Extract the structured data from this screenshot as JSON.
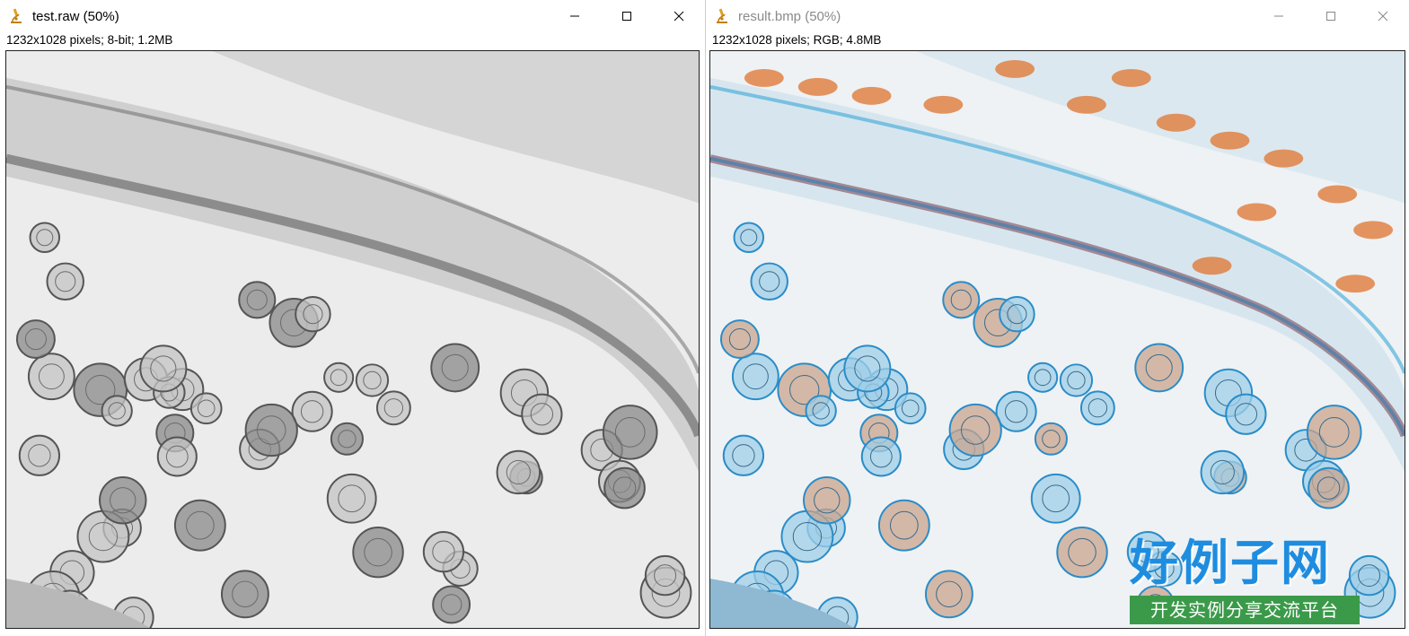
{
  "colors": {
    "brand_blue": "#1e8de0",
    "brand_green": "#3b9a4a",
    "stain_blue": "#3aa6d8",
    "stain_orange": "#e07a3a"
  },
  "windows": [
    {
      "title": "test.raw (50%)",
      "info": "1232x1028 pixels; 8-bit; 1.2MB",
      "icon": "microscope-icon",
      "active": true
    },
    {
      "title": "result.bmp (50%)",
      "info": "1232x1028 pixels; RGB; 4.8MB",
      "icon": "microscope-icon",
      "active": false
    }
  ],
  "branding": {
    "main": "好例子网",
    "sub": "开发实例分享交流平台"
  }
}
